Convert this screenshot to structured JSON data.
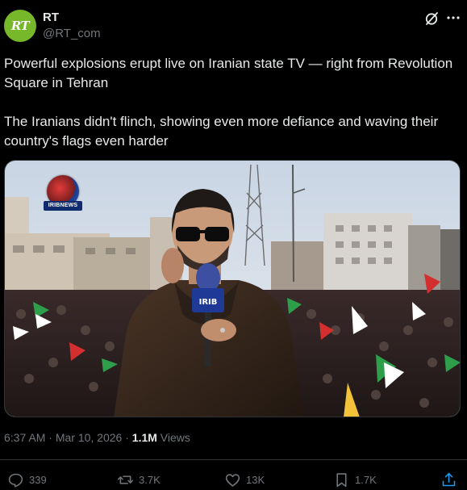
{
  "author": {
    "avatar_text": "RT",
    "name": "RT",
    "handle": "@RT_com"
  },
  "header_icons": [
    "grok-icon",
    "more-icon"
  ],
  "tweet": {
    "paragraph_1": "Powerful explosions erupt live on Iranian state TV — right from Revolution Square in Tehran",
    "paragraph_2": "The Iranians didn't flinch, showing even more defiance and waving their country's flags even harder"
  },
  "media": {
    "broadcaster_tag": "IRIBNEWS",
    "mic_label": "IRIB"
  },
  "meta": {
    "time": "6:37 AM",
    "separator": "·",
    "date": "Mar 10, 2026",
    "views_count": "1.1M",
    "views_label": "Views"
  },
  "actions": {
    "replies": "339",
    "reposts": "3.7K",
    "likes": "13K",
    "bookmarks": "1.7K"
  },
  "colors": {
    "background": "#000000",
    "text_primary": "#e7e9ea",
    "text_secondary": "#71767b",
    "divider": "#2f3336",
    "avatar": "#77b72a"
  }
}
